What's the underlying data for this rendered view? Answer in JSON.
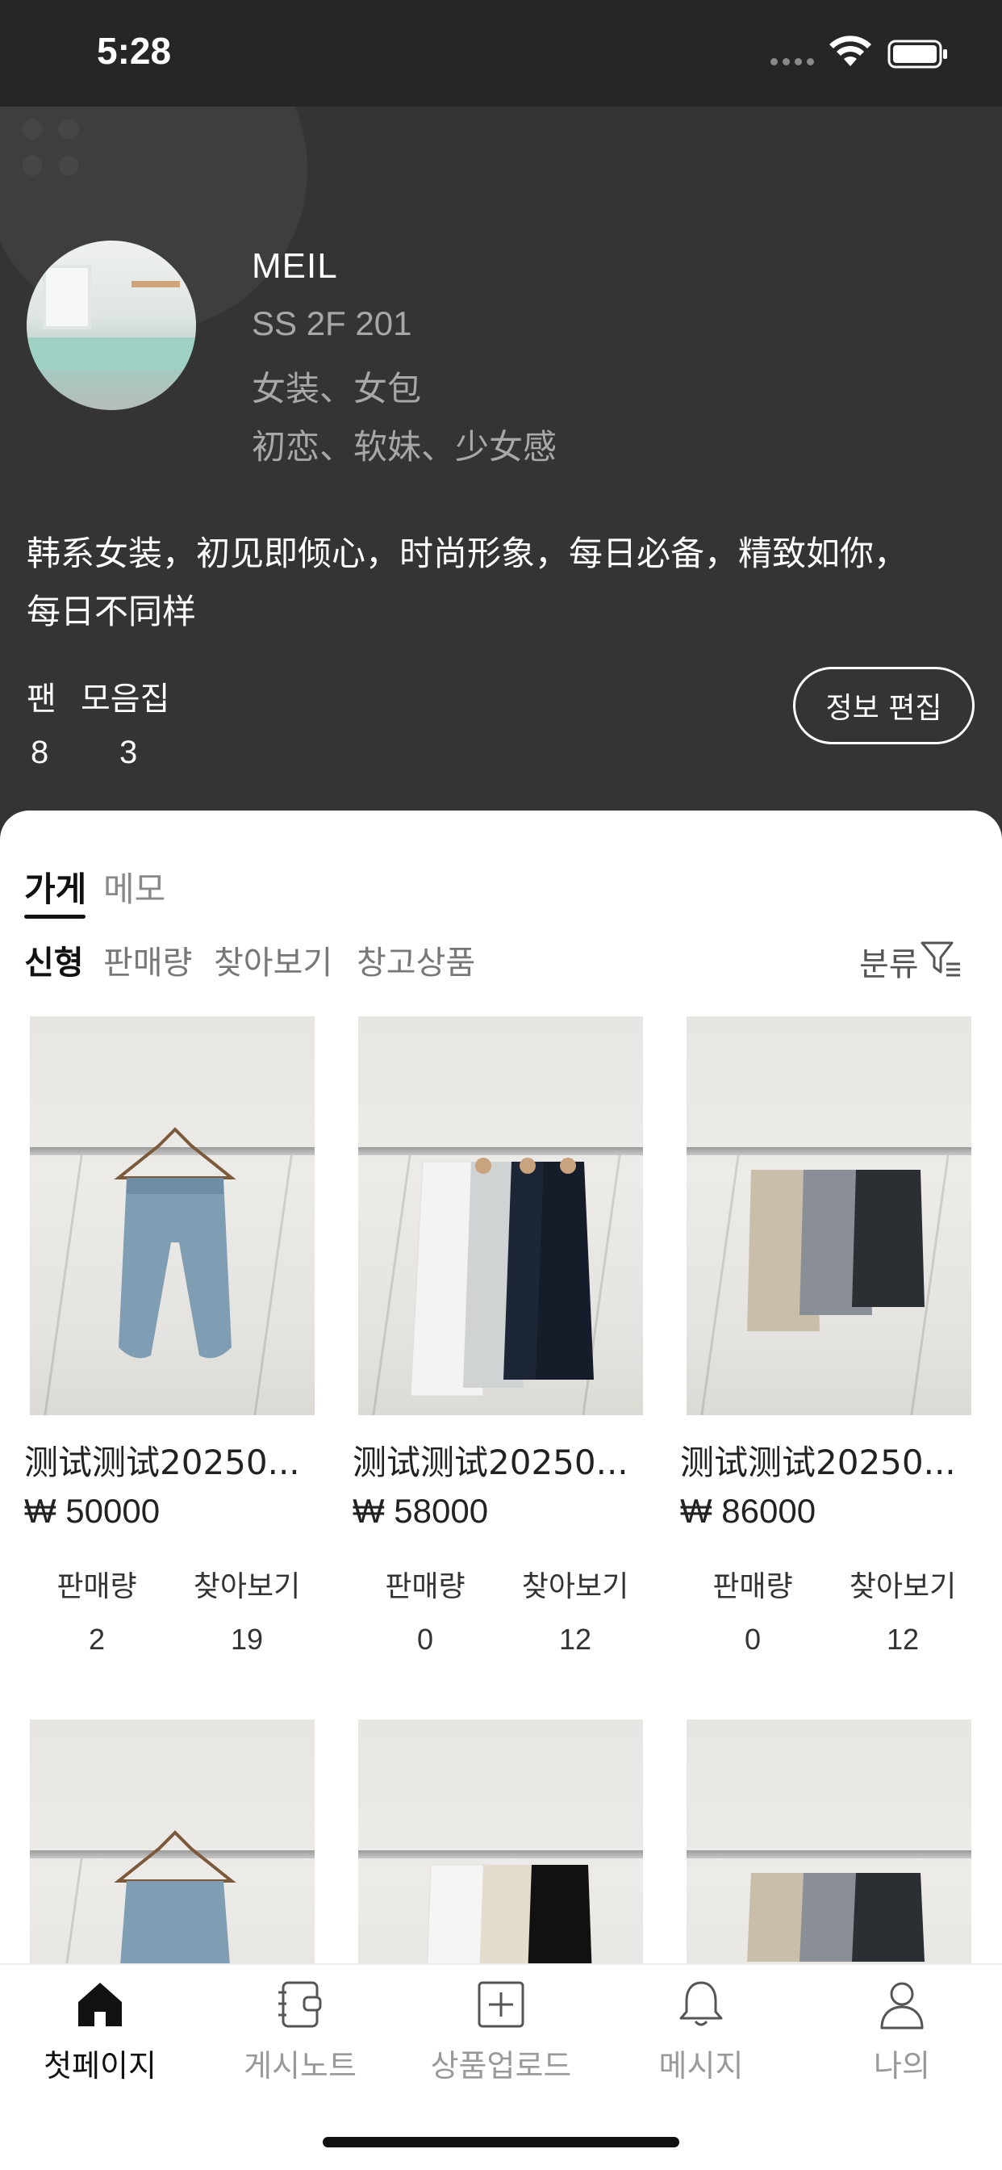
{
  "status_bar": {
    "time": "5:28"
  },
  "profile": {
    "name": "MEIL",
    "location": "SS 2F 201",
    "category": "女装、女包",
    "tags": "初恋、软妹、少女感",
    "description_line1": "韩系女装，初见即倾心，时尚形象，每日必备，精致如你，",
    "description_line2": "每日不同样",
    "fans_label": "팬",
    "fans_count": "8",
    "collection_label": "모음집",
    "collection_count": "3",
    "edit_button": "정보 편집"
  },
  "tabs": [
    {
      "label": "가게",
      "active": true
    },
    {
      "label": "메모",
      "active": false
    }
  ],
  "subtabs": [
    {
      "label": "신형",
      "active": true
    },
    {
      "label": "판매량",
      "active": false
    },
    {
      "label": "찾아보기",
      "active": false
    },
    {
      "label": "창고상품",
      "active": false
    }
  ],
  "category_filter": "분류",
  "stat_labels": {
    "sales": "판매량",
    "views": "찾아보기"
  },
  "products": [
    {
      "title": "测试测试20250...",
      "price": "₩ 50000",
      "sales": "2",
      "views": "19"
    },
    {
      "title": "测试测试20250...",
      "price": "₩ 58000",
      "sales": "0",
      "views": "12"
    },
    {
      "title": "测试测试20250...",
      "price": "₩ 86000",
      "sales": "0",
      "views": "12"
    }
  ],
  "bottom_nav": [
    {
      "label": "첫페이지",
      "icon": "home-icon",
      "active": true
    },
    {
      "label": "게시노트",
      "icon": "notebook-icon",
      "active": false
    },
    {
      "label": "상품업로드",
      "icon": "upload-plus-icon",
      "active": false
    },
    {
      "label": "메시지",
      "icon": "bell-icon",
      "active": false
    },
    {
      "label": "나의",
      "icon": "person-icon",
      "active": false
    }
  ]
}
